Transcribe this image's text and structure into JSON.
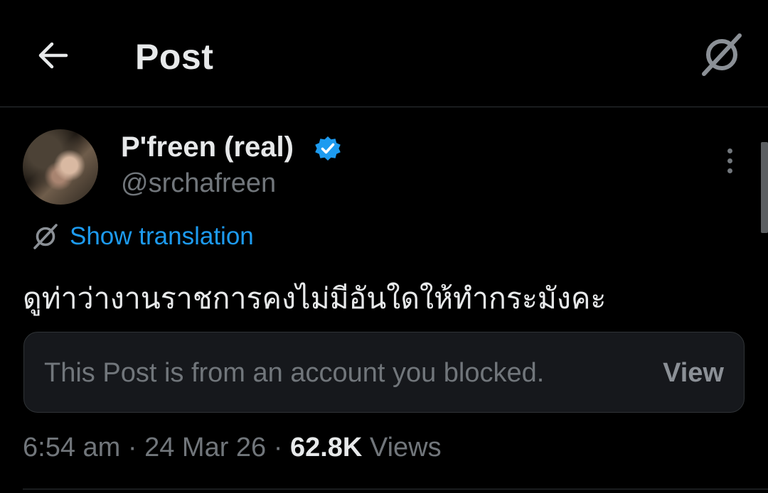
{
  "header": {
    "title": "Post",
    "back_icon": "arrow-left-icon",
    "translate_icon": "translate-icon"
  },
  "author": {
    "name": "P'freen (real)",
    "handle": "@srchafreen",
    "verified": true,
    "verified_color": "#1d9bf0"
  },
  "translation": {
    "label": "Show translation",
    "color": "#1d9bf0"
  },
  "post": {
    "text": "ดูท่าว่างานราชการคงไม่มีอันใดให้ทำกระมังคะ"
  },
  "quoted": {
    "message": "This Post is from an account you blocked.",
    "action_label": "View"
  },
  "meta": {
    "time": "6:54 am",
    "separator1": " · ",
    "date": "24 Mar 26",
    "separator2": " · ",
    "views_count": "62.8K",
    "views_label": " Views"
  },
  "colors": {
    "background": "#000000",
    "text_primary": "#e7e9ea",
    "text_secondary": "#71767b",
    "border": "#2f3336",
    "accent": "#1d9bf0"
  }
}
